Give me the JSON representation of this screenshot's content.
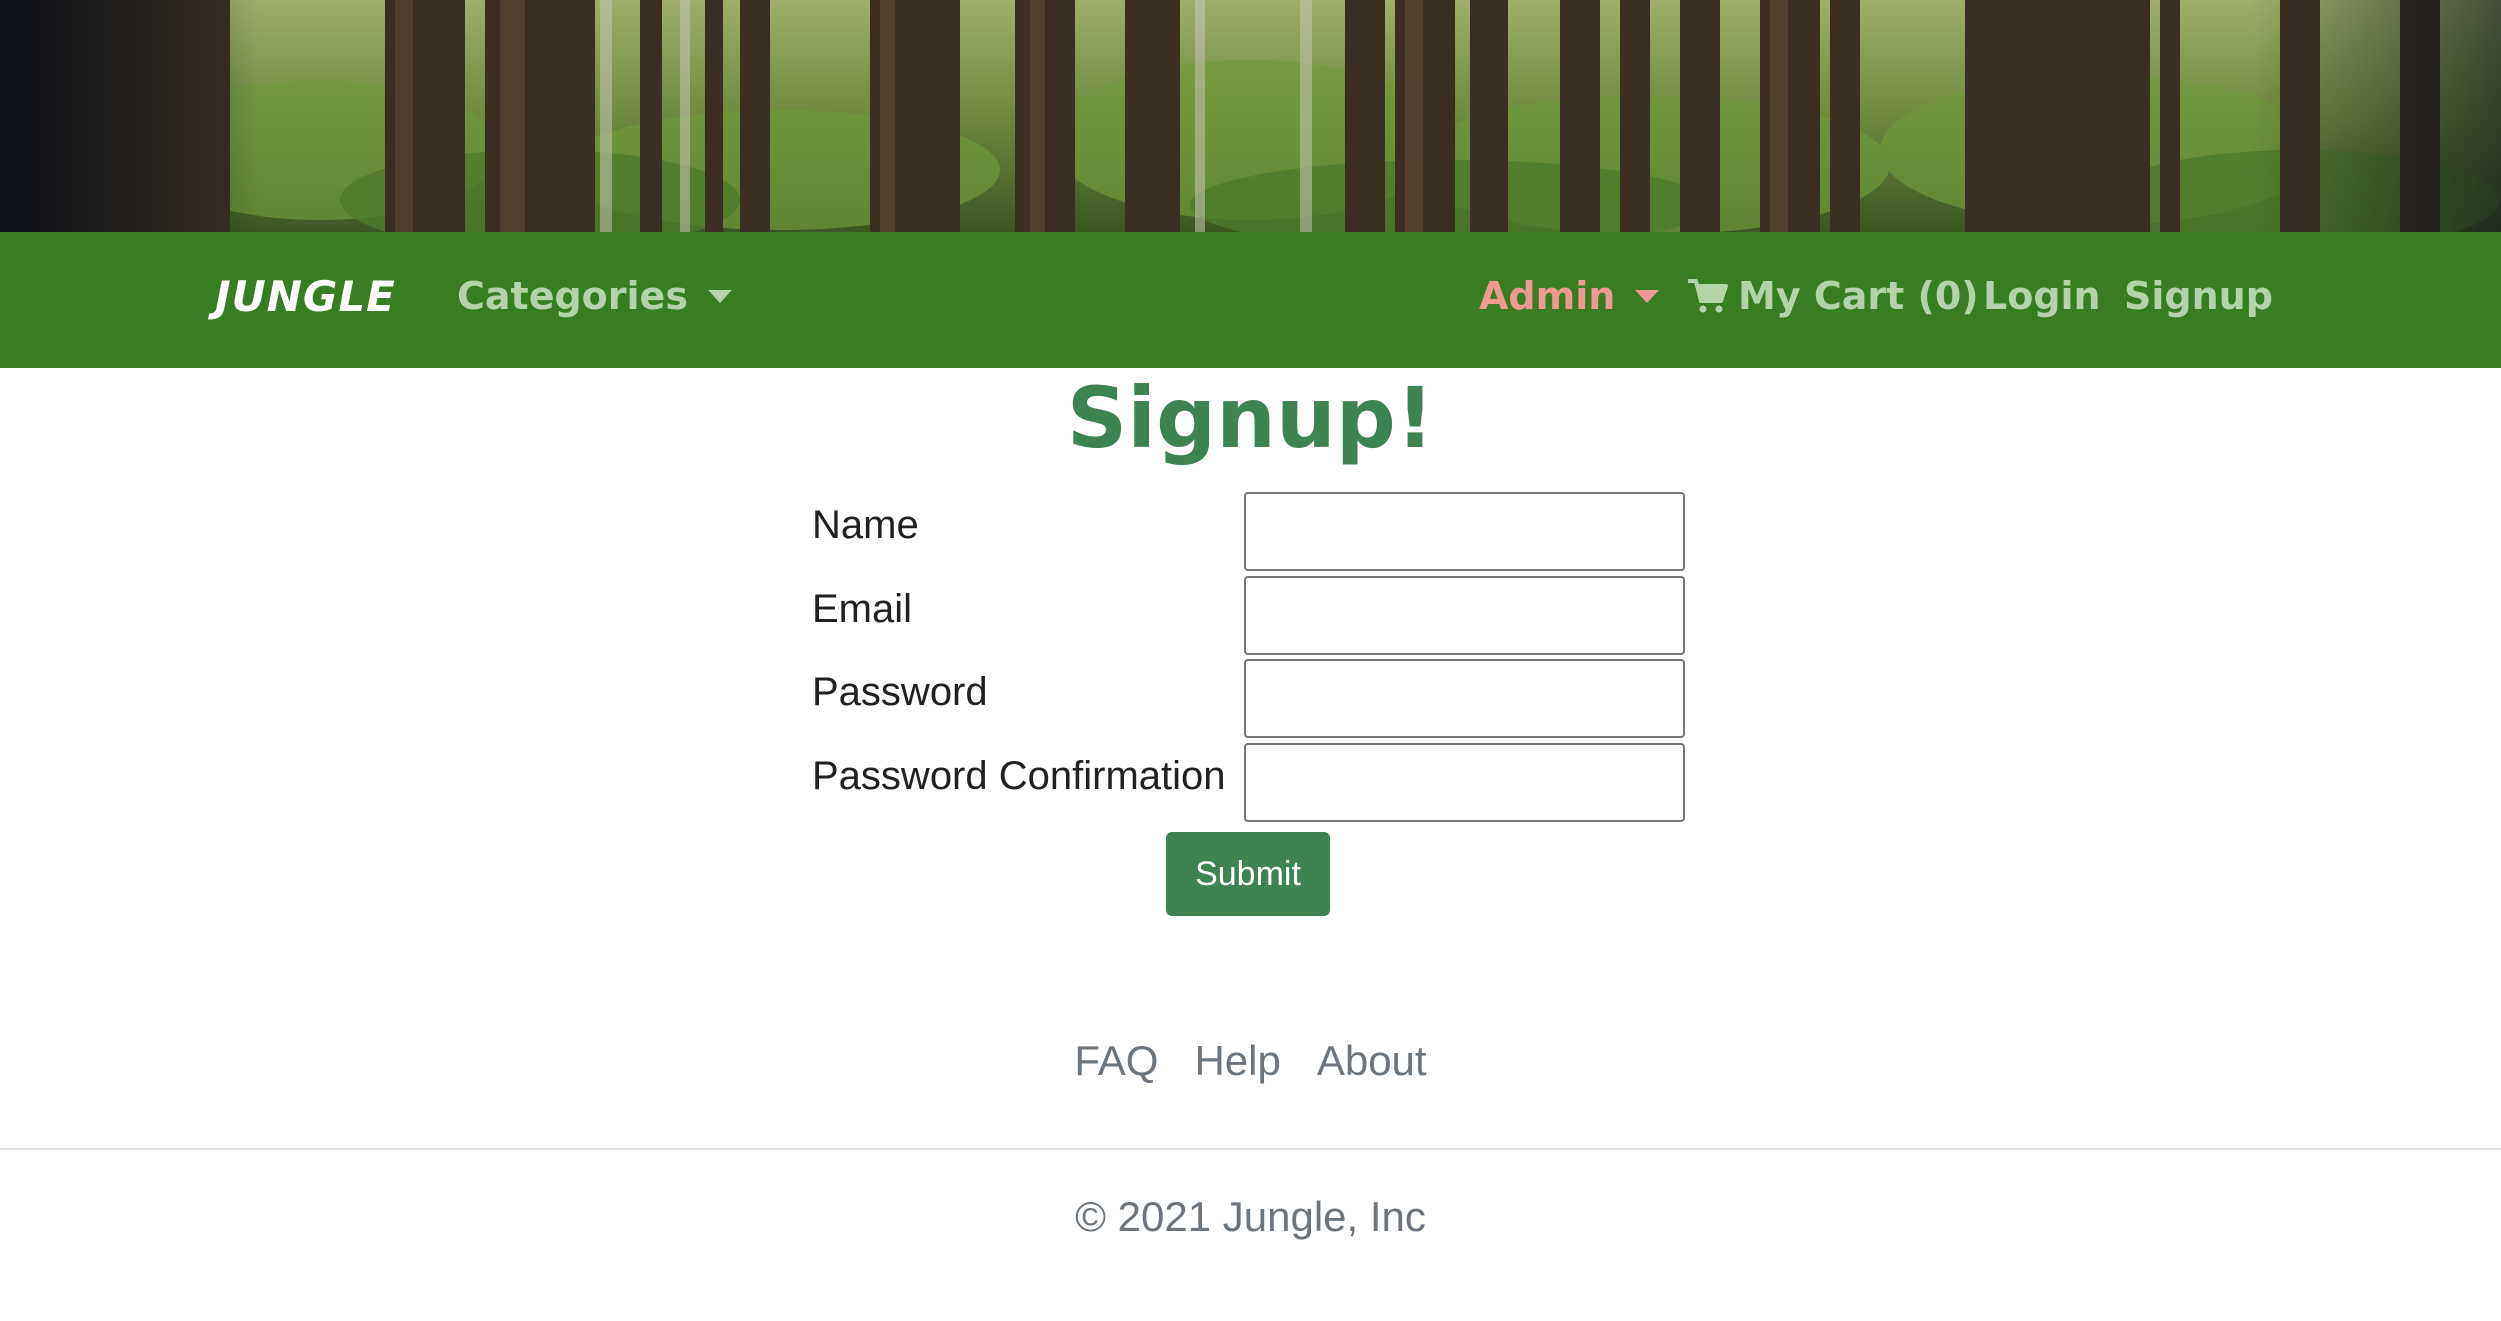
{
  "colors": {
    "navbar_bg": "#397d22",
    "brand_text": "#ffffff",
    "nav_link": "#b5d3a8",
    "admin_link": "#ee9a8f",
    "title_green": "#3d8452",
    "button_green": "#3d8452",
    "muted_text": "#6c757d"
  },
  "navbar": {
    "brand": "JUNGLE",
    "categories_label": "Categories",
    "admin_label": "Admin",
    "cart_label": "My Cart (0)",
    "cart_icon": "shopping-cart-icon",
    "login_label": "Login",
    "signup_label": "Signup"
  },
  "page": {
    "title": "Signup!"
  },
  "form": {
    "fields": [
      {
        "label": "Name",
        "value": ""
      },
      {
        "label": "Email",
        "value": ""
      },
      {
        "label": "Password",
        "value": ""
      },
      {
        "label": "Password Confirmation",
        "value": ""
      }
    ],
    "submit_label": "Submit"
  },
  "footer": {
    "links": [
      "FAQ",
      "Help",
      "About"
    ],
    "copyright": "© 2021 Jungle, Inc"
  }
}
